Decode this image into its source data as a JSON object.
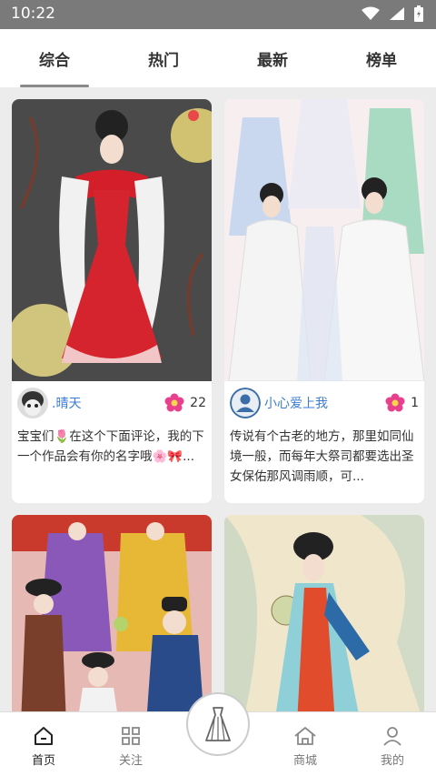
{
  "status": {
    "time": "10:22"
  },
  "tabs": [
    {
      "label": "综合",
      "active": true
    },
    {
      "label": "热门",
      "active": false
    },
    {
      "label": "最新",
      "active": false
    },
    {
      "label": "榜单",
      "active": false
    }
  ],
  "cards": [
    {
      "user": ".晴天",
      "likes": "22",
      "desc": "宝宝们🌷在这个下面评论，我的下一个作品会有你的名字哦🌸🎀..."
    },
    {
      "user": "小心爱上我",
      "likes": "1",
      "desc": "传说有个古老的地方，那里如同仙境一般，而每年大祭司都要选出圣女保佑那风调雨顺，可..."
    }
  ],
  "bottom_nav": [
    {
      "label": "首页",
      "icon": "home-icon"
    },
    {
      "label": "关注",
      "icon": "grid-icon"
    },
    {
      "label": "商城",
      "icon": "shop-icon"
    },
    {
      "label": "我的",
      "icon": "user-icon"
    }
  ],
  "center_button": {
    "icon": "dress-icon"
  }
}
